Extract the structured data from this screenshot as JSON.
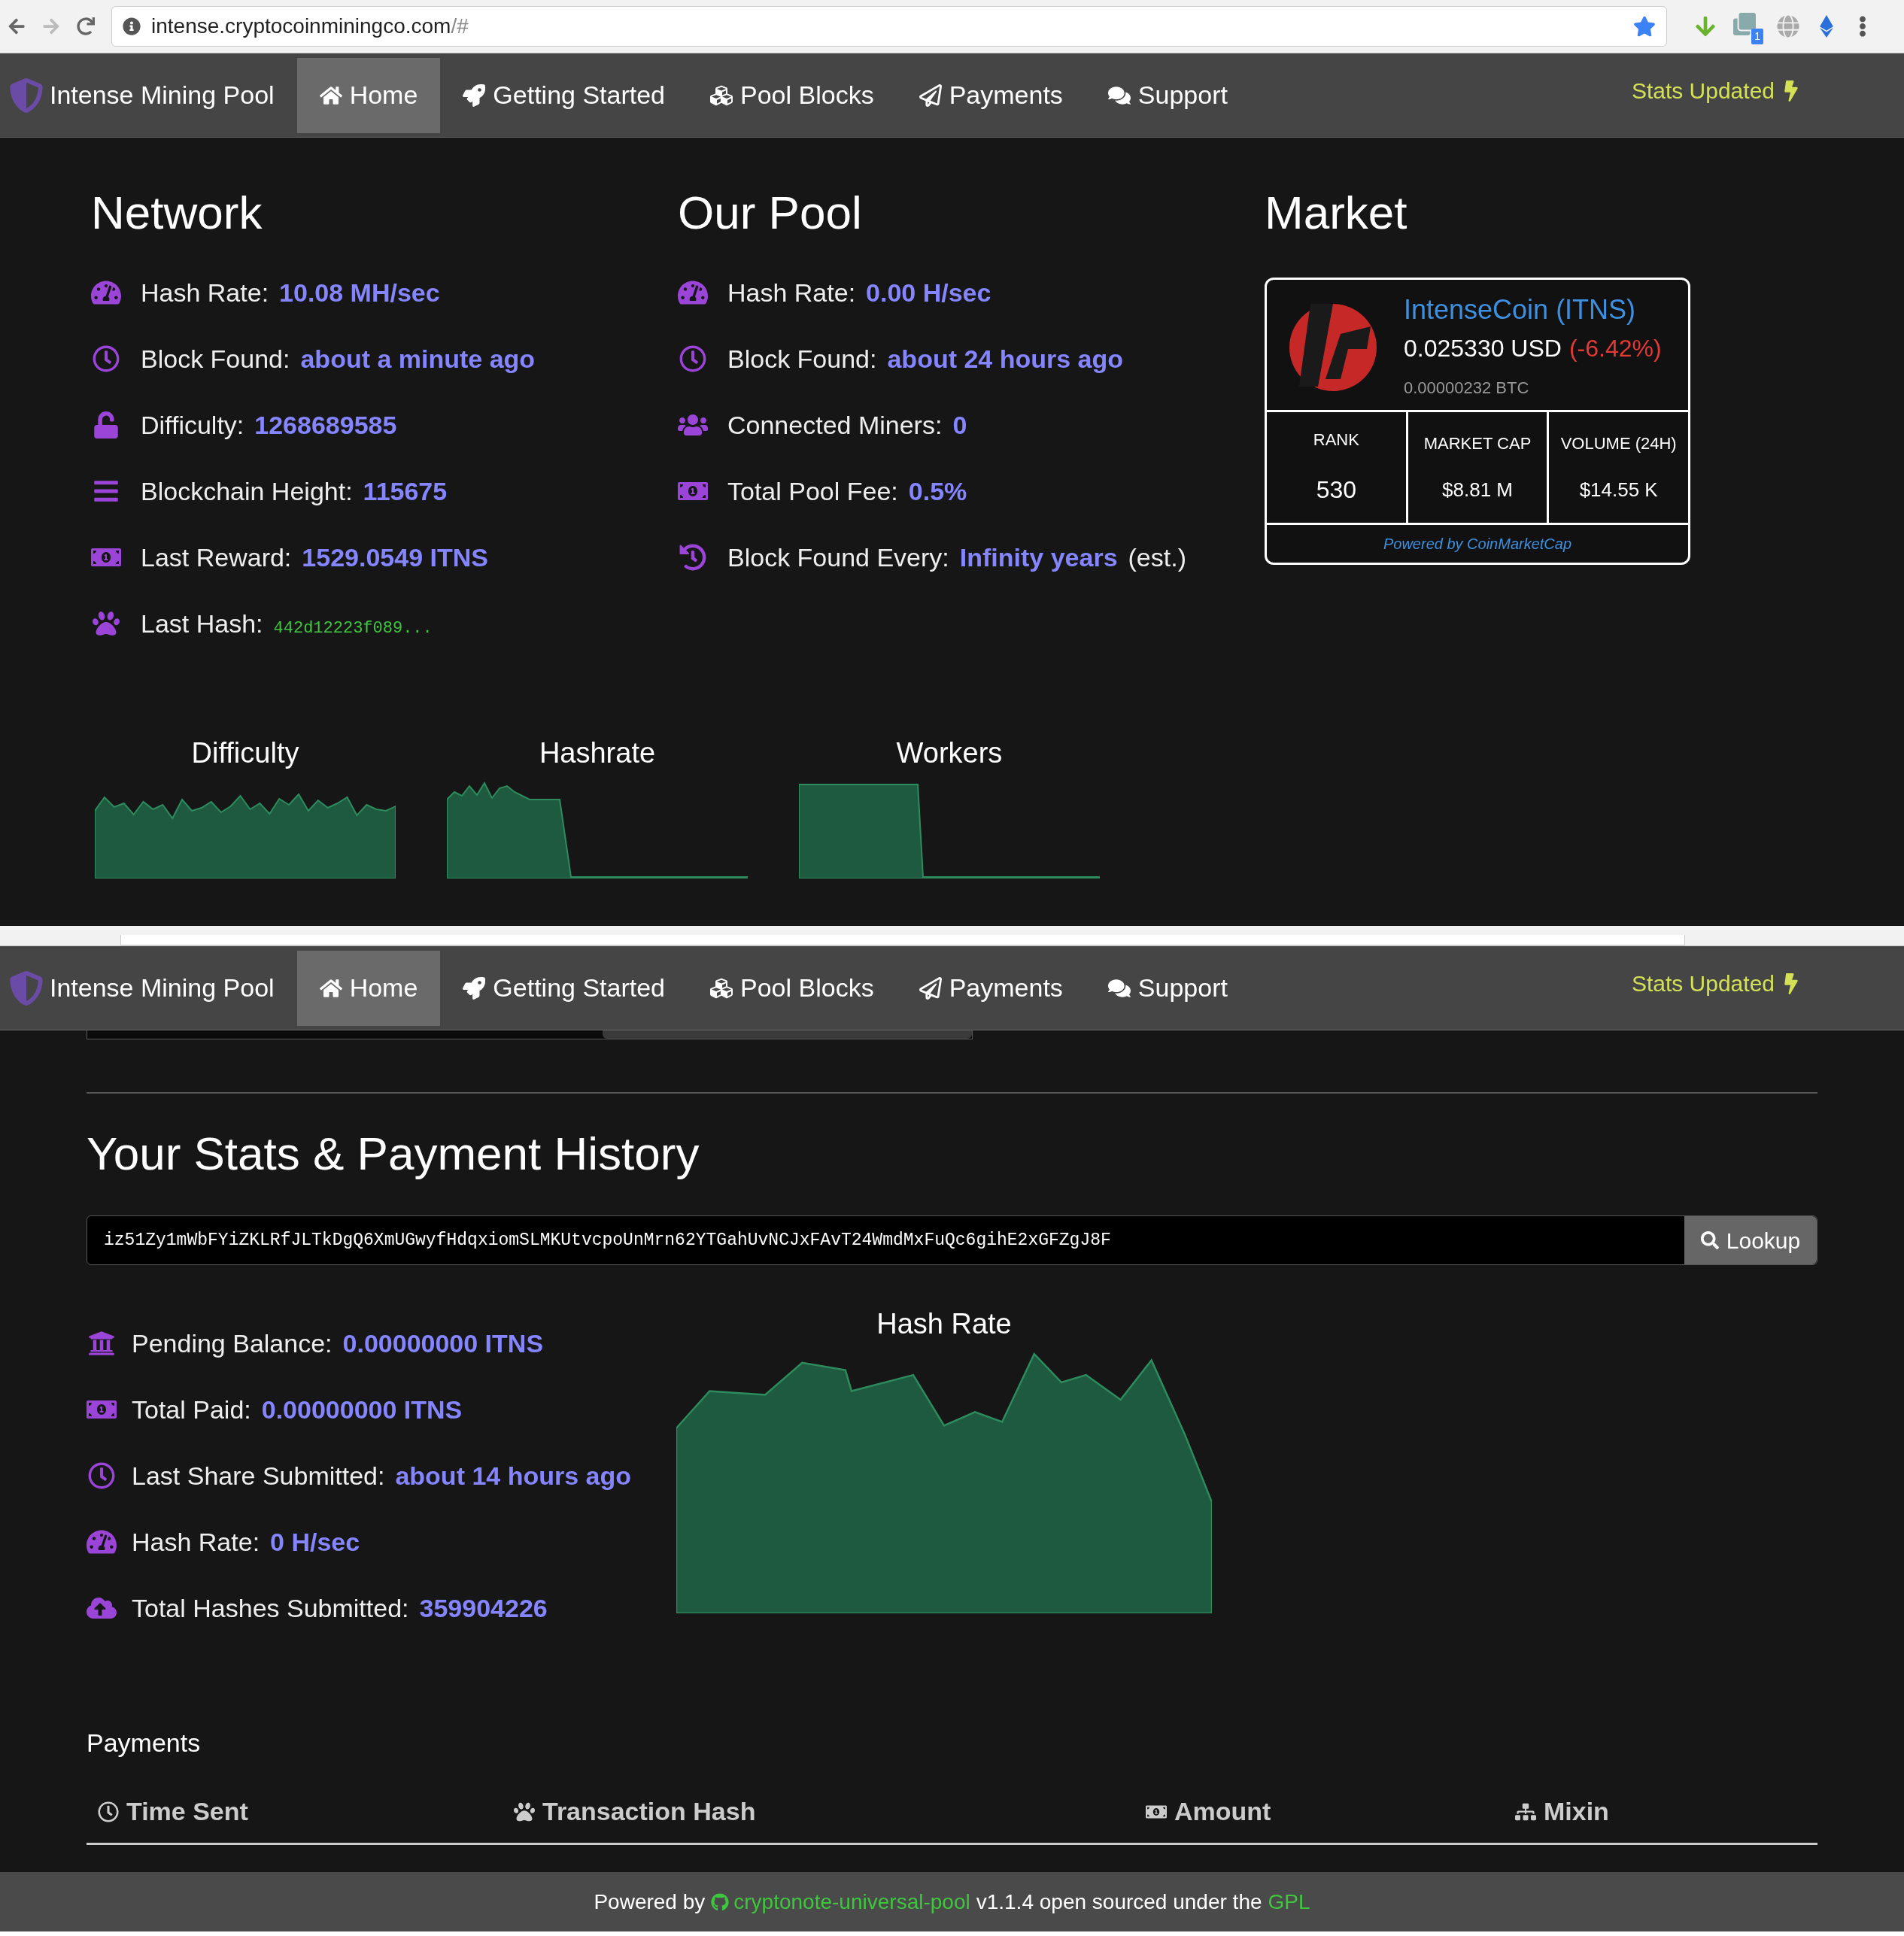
{
  "browser": {
    "url_host": "intense.cryptocoinminingco.com",
    "url_path": "/#",
    "extension_badge": "1"
  },
  "navbars": [
    {
      "brand": "Intense Mining Pool",
      "items": [
        {
          "label": "Home",
          "selected": true
        },
        {
          "label": "Getting Started",
          "selected": false
        },
        {
          "label": "Pool Blocks",
          "selected": false
        },
        {
          "label": "Payments",
          "selected": false
        },
        {
          "label": "Support",
          "selected": false
        }
      ],
      "status": "Stats Updated"
    },
    {
      "brand": "Intense Mining Pool",
      "items": [
        {
          "label": "Home",
          "selected": true
        },
        {
          "label": "Getting Started",
          "selected": false
        },
        {
          "label": "Pool Blocks",
          "selected": false
        },
        {
          "label": "Payments",
          "selected": false
        },
        {
          "label": "Support",
          "selected": false
        }
      ],
      "status": "Stats Updated"
    }
  ],
  "network": {
    "title": "Network",
    "stats": [
      {
        "label": "Hash Rate:",
        "value": "10.08 MH/sec",
        "kind": "value"
      },
      {
        "label": "Block Found:",
        "value": "about a minute ago",
        "kind": "value"
      },
      {
        "label": "Difficulty:",
        "value": "1268689585",
        "kind": "value"
      },
      {
        "label": "Blockchain Height:",
        "value": "115675",
        "kind": "value"
      },
      {
        "label": "Last Reward:",
        "value": "1529.0549 ITNS",
        "kind": "value"
      },
      {
        "label": "Last Hash:",
        "value": "442d12223f089...",
        "kind": "hash"
      }
    ]
  },
  "our_pool": {
    "title": "Our Pool",
    "stats": [
      {
        "label": "Hash Rate:",
        "value": "0.00 H/sec"
      },
      {
        "label": "Block Found:",
        "value": "about 24 hours ago"
      },
      {
        "label": "Connected Miners:",
        "value": "0"
      },
      {
        "label": "Total Pool Fee:",
        "value": "0.5%"
      },
      {
        "label": "Block Found Every:",
        "value": "Infinity years",
        "suffix": "(est.)"
      }
    ]
  },
  "market": {
    "title": "Market",
    "coin": "IntenseCoin (ITNS)",
    "price": "0.025330 USD",
    "change": "(-6.42%)",
    "btc": "0.00000232 BTC",
    "columns": [
      {
        "label": "RANK",
        "value": "530"
      },
      {
        "label": "MARKET CAP",
        "value": "$8.81 M"
      },
      {
        "label": "VOLUME (24H)",
        "value": "$14.55 K"
      }
    ],
    "footer": "Powered by CoinMarketCap"
  },
  "sparklines": [
    {
      "title": "Difficulty"
    },
    {
      "title": "Hashrate"
    },
    {
      "title": "Workers"
    }
  ],
  "your_stats": {
    "title": "Your Stats & Payment History",
    "address": "iz51Zy1mWbFYiZKLRfJLTkDgQ6XmUGwyfHdqxiomSLMKUtvcpoUnMrn62YTGahUvNCJxFAvT24WmdMxFuQc6gihE2xGFZgJ8F",
    "lookup": "Lookup",
    "stats": [
      {
        "label": "Pending Balance:",
        "value": "0.00000000 ITNS"
      },
      {
        "label": "Total Paid:",
        "value": "0.00000000 ITNS"
      },
      {
        "label": "Last Share Submitted:",
        "value": "about 14 hours ago"
      },
      {
        "label": "Hash Rate:",
        "value": "0 H/sec"
      },
      {
        "label": "Total Hashes Submitted:",
        "value": "359904226"
      }
    ],
    "chart_title": "Hash Rate"
  },
  "payments": {
    "title": "Payments",
    "columns": [
      "Time Sent",
      "Transaction Hash",
      "Amount",
      "Mixin"
    ]
  },
  "footer": {
    "prefix": "Powered by",
    "project": "cryptonote-universal-pool",
    "middle": "v1.1.4 open sourced under the",
    "license": "GPL"
  }
}
